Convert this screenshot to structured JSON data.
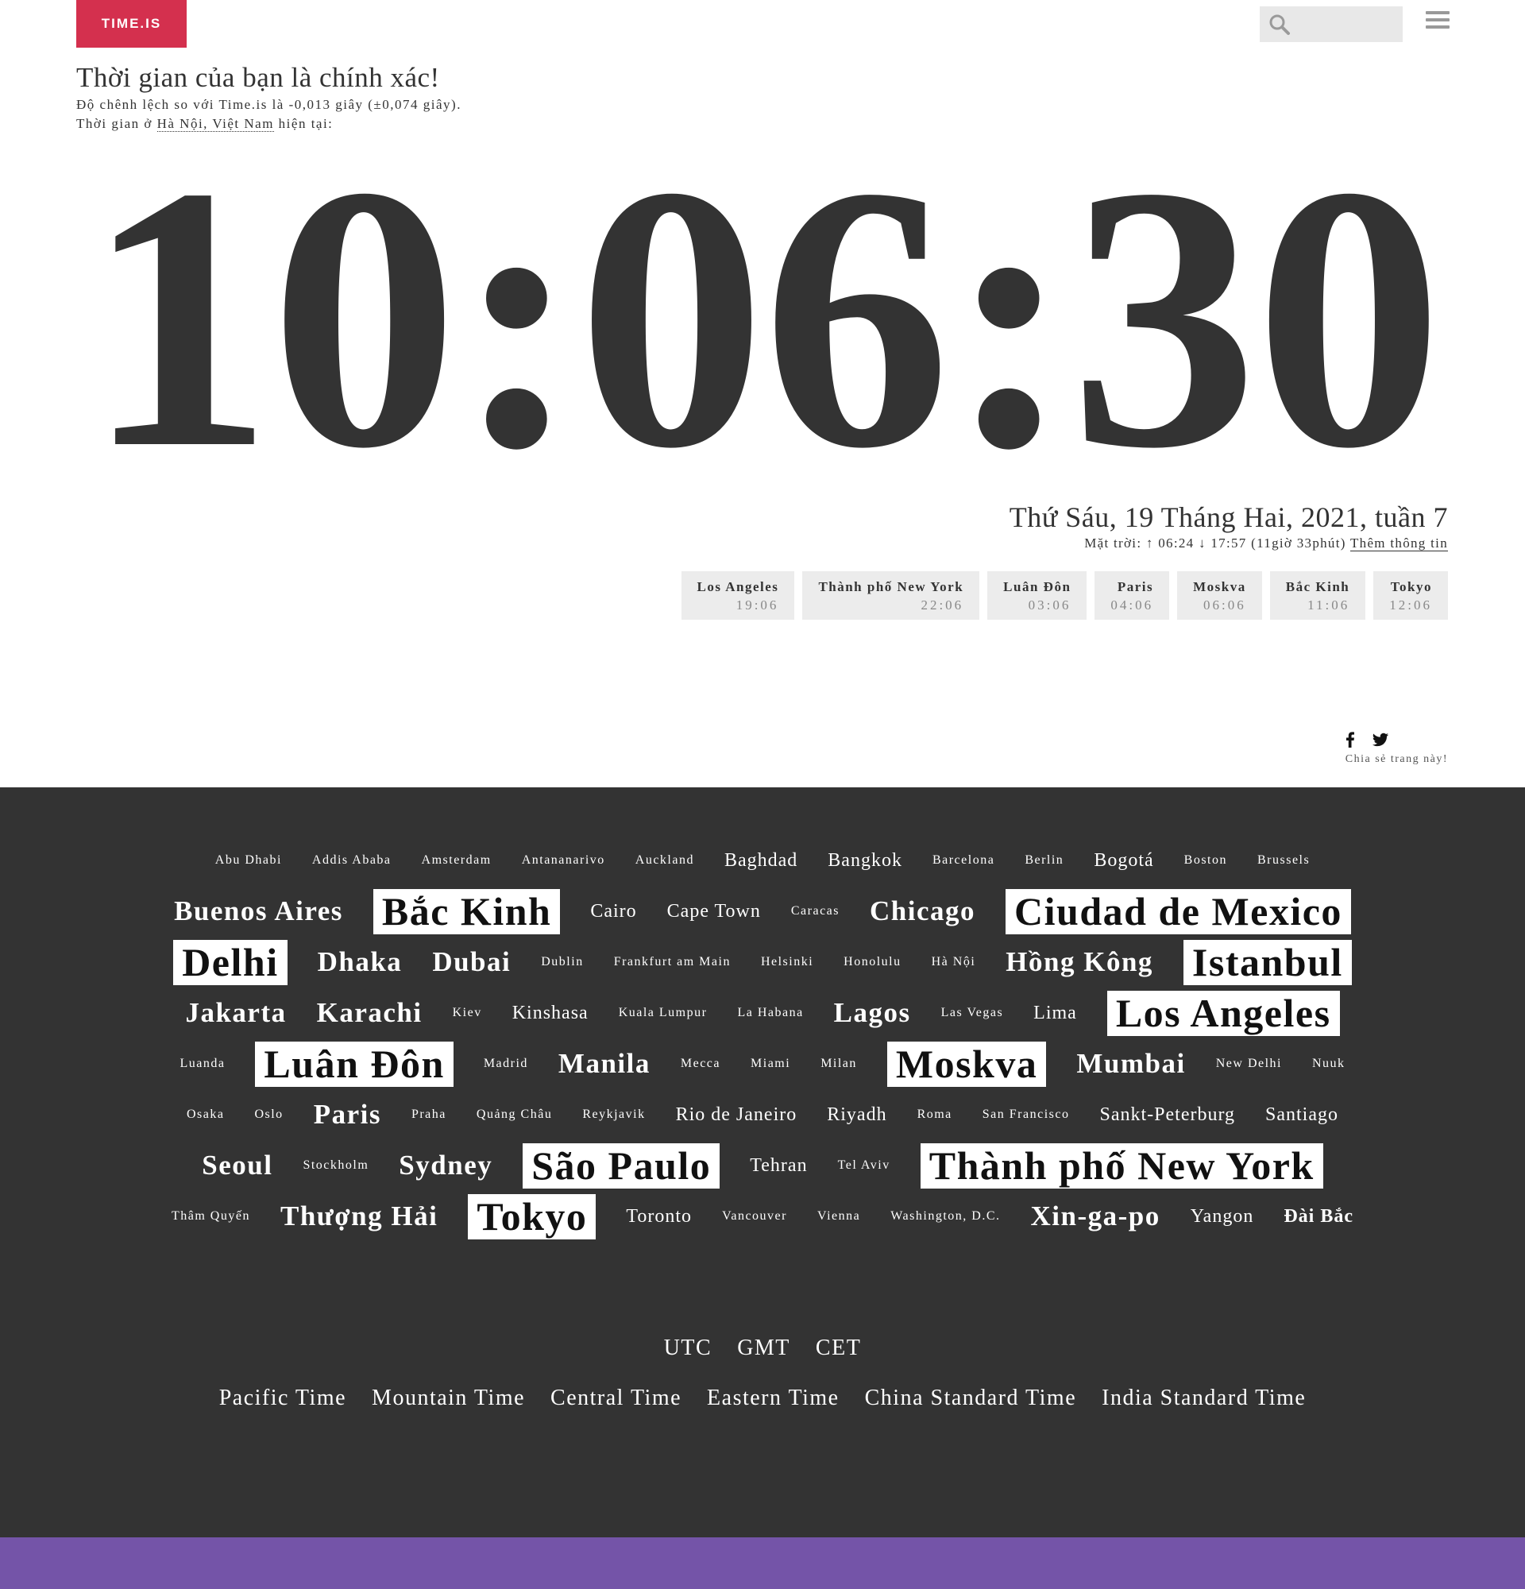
{
  "header": {
    "logo": "TIME.IS",
    "search_placeholder": "",
    "icons": {
      "search": "search-icon",
      "menu": "menu-icon"
    }
  },
  "intro": {
    "headline": "Thời gian của bạn là chính xác!",
    "offset_text": "Độ chênh lệch so với Time.is là -0,013 giây (±0,074 giây).",
    "location_prefix": "Thời gian ở ",
    "location_link": "Hà Nội, Việt Nam",
    "location_suffix": " hiện tại:"
  },
  "clock": {
    "time": "10:06:30"
  },
  "date": {
    "full": "Thứ Sáu, 19 Tháng Hai, 2021, tuần 7",
    "sun_text": "Mặt trời: ↑ 06:24 ↓ 17:57 (11giờ 33phút) ",
    "more_link": "Thêm thông tin"
  },
  "mini_clocks": [
    {
      "name": "Los Angeles",
      "time": "19:06"
    },
    {
      "name": "Thành phố New York",
      "time": "22:06"
    },
    {
      "name": "Luân Đôn",
      "time": "03:06"
    },
    {
      "name": "Paris",
      "time": "04:06"
    },
    {
      "name": "Moskva",
      "time": "06:06"
    },
    {
      "name": "Bắc Kinh",
      "time": "11:06"
    },
    {
      "name": "Tokyo",
      "time": "12:06"
    }
  ],
  "share": {
    "text": "Chia sẻ trang này!",
    "icons": [
      "facebook-icon",
      "twitter-icon"
    ]
  },
  "cities": [
    {
      "name": "Abu Dhabi",
      "size": 1
    },
    {
      "name": "Addis Ababa",
      "size": 1
    },
    {
      "name": "Amsterdam",
      "size": 1
    },
    {
      "name": "Antananarivo",
      "size": 1
    },
    {
      "name": "Auckland",
      "size": 1
    },
    {
      "name": "Baghdad",
      "size": 2
    },
    {
      "name": "Bangkok",
      "size": 2
    },
    {
      "name": "Barcelona",
      "size": 1
    },
    {
      "name": "Berlin",
      "size": 1
    },
    {
      "name": "Bogotá",
      "size": 2
    },
    {
      "name": "Boston",
      "size": 1
    },
    {
      "name": "Brussels",
      "size": 1
    },
    {
      "name": "Buenos Aires",
      "size": 3
    },
    {
      "name": "Bắc Kinh",
      "size": 4,
      "highlight": true
    },
    {
      "name": "Cairo",
      "size": 2
    },
    {
      "name": "Cape Town",
      "size": 2
    },
    {
      "name": "Caracas",
      "size": 1
    },
    {
      "name": "Chicago",
      "size": 3
    },
    {
      "name": "Ciudad de Mexico",
      "size": 4,
      "highlight": true
    },
    {
      "name": "Delhi",
      "size": 4,
      "highlight": true
    },
    {
      "name": "Dhaka",
      "size": 3
    },
    {
      "name": "Dubai",
      "size": 3
    },
    {
      "name": "Dublin",
      "size": 1
    },
    {
      "name": "Frankfurt am Main",
      "size": 1
    },
    {
      "name": "Helsinki",
      "size": 1
    },
    {
      "name": "Honolulu",
      "size": 1
    },
    {
      "name": "Hà Nội",
      "size": 1
    },
    {
      "name": "Hồng Kông",
      "size": 3
    },
    {
      "name": "Istanbul",
      "size": 4,
      "highlight": true
    },
    {
      "name": "Jakarta",
      "size": 3
    },
    {
      "name": "Karachi",
      "size": 3
    },
    {
      "name": "Kiev",
      "size": 1
    },
    {
      "name": "Kinshasa",
      "size": 2
    },
    {
      "name": "Kuala Lumpur",
      "size": 1
    },
    {
      "name": "La Habana",
      "size": 1
    },
    {
      "name": "Lagos",
      "size": 3
    },
    {
      "name": "Las Vegas",
      "size": 1
    },
    {
      "name": "Lima",
      "size": 2
    },
    {
      "name": "Los Angeles",
      "size": 4,
      "highlight": true
    },
    {
      "name": "Luanda",
      "size": 1
    },
    {
      "name": "Luân Đôn",
      "size": 4,
      "highlight": true
    },
    {
      "name": "Madrid",
      "size": 1
    },
    {
      "name": "Manila",
      "size": 3
    },
    {
      "name": "Mecca",
      "size": 1
    },
    {
      "name": "Miami",
      "size": 1
    },
    {
      "name": "Milan",
      "size": 1
    },
    {
      "name": "Moskva",
      "size": 4,
      "highlight": true
    },
    {
      "name": "Mumbai",
      "size": 3
    },
    {
      "name": "New Delhi",
      "size": 1
    },
    {
      "name": "Nuuk",
      "size": 1
    },
    {
      "name": "Osaka",
      "size": 1
    },
    {
      "name": "Oslo",
      "size": 1
    },
    {
      "name": "Paris",
      "size": 3
    },
    {
      "name": "Praha",
      "size": 1
    },
    {
      "name": "Quảng Châu",
      "size": 1
    },
    {
      "name": "Reykjavik",
      "size": 1
    },
    {
      "name": "Rio de Janeiro",
      "size": 2
    },
    {
      "name": "Riyadh",
      "size": 2
    },
    {
      "name": "Roma",
      "size": 1
    },
    {
      "name": "San Francisco",
      "size": 1
    },
    {
      "name": "Sankt-Peterburg",
      "size": 2
    },
    {
      "name": "Santiago",
      "size": 2
    },
    {
      "name": "Seoul",
      "size": 3
    },
    {
      "name": "Stockholm",
      "size": 1
    },
    {
      "name": "Sydney",
      "size": 3
    },
    {
      "name": "São Paulo",
      "size": 4,
      "highlight": true
    },
    {
      "name": "Tehran",
      "size": 2
    },
    {
      "name": "Tel Aviv",
      "size": 1
    },
    {
      "name": "Thành phố New York",
      "size": 4,
      "highlight": true
    },
    {
      "name": "Thâm Quyến",
      "size": 1
    },
    {
      "name": "Thượng Hải",
      "size": 3
    },
    {
      "name": "Tokyo",
      "size": 4,
      "highlight": true
    },
    {
      "name": "Toronto",
      "size": 2
    },
    {
      "name": "Vancouver",
      "size": 1
    },
    {
      "name": "Vienna",
      "size": 1
    },
    {
      "name": "Washington, D.C.",
      "size": 1
    },
    {
      "name": "Xin-ga-po",
      "size": 3
    },
    {
      "name": "Yangon",
      "size": 2
    },
    {
      "name": "Đài Bắc",
      "size": 2,
      "bold": true
    }
  ],
  "zones_primary": [
    "UTC",
    "GMT",
    "CET"
  ],
  "zones_secondary": [
    "Pacific Time",
    "Mountain Time",
    "Central Time",
    "Eastern Time",
    "China Standard Time",
    "India Standard Time"
  ],
  "colors": {
    "brand": "#d4304e",
    "dark_bg": "#333333",
    "footer": "#7454a8",
    "mini_clock_bg": "#ececec"
  }
}
